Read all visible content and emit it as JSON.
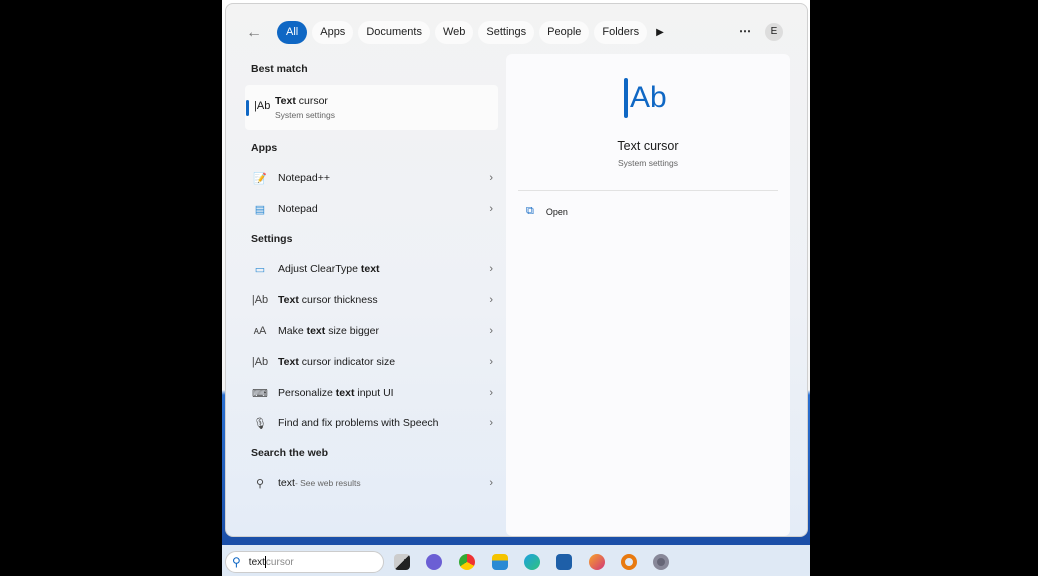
{
  "filters": {
    "items": [
      "All",
      "Apps",
      "Documents",
      "Web",
      "Settings",
      "People",
      "Folders"
    ],
    "active": "All",
    "more": "⋯",
    "avatar": "E"
  },
  "best_match": {
    "header": "Best match",
    "title_bold": "Text",
    "title_rest": " cursor",
    "subtitle": "System settings",
    "icon": "Ab"
  },
  "apps": {
    "header": "Apps",
    "items": [
      {
        "label": "Notepad++",
        "icon": "notepad-plus-plus-icon"
      },
      {
        "label": "Notepad",
        "icon": "notepad-icon"
      }
    ]
  },
  "settings": {
    "header": "Settings",
    "items": [
      {
        "pre": "Adjust ClearType ",
        "bold": "text",
        "post": "",
        "icon": "monitor-icon"
      },
      {
        "pre": "",
        "bold": "Text",
        "post": " cursor thickness",
        "icon": "text-cursor-icon"
      },
      {
        "pre": "Make ",
        "bold": "text",
        "post": " size bigger",
        "icon": "text-size-icon"
      },
      {
        "pre": "",
        "bold": "Text",
        "post": " cursor indicator size",
        "icon": "text-cursor-icon"
      },
      {
        "pre": "Personalize ",
        "bold": "text",
        "post": " input UI",
        "icon": "keyboard-icon"
      },
      {
        "pre": "Find and fix problems with Speech",
        "bold": "",
        "post": "",
        "icon": "microphone-icon"
      }
    ]
  },
  "web": {
    "header": "Search the web",
    "query": "text",
    "suffix": " - See web results"
  },
  "preview": {
    "title": "Text cursor",
    "subtitle": "System settings",
    "open": "Open",
    "icon": "Ab"
  },
  "taskbar": {
    "typed": "text",
    "placeholder": "cursor",
    "apps": [
      "task-view",
      "teams-chat",
      "chrome",
      "file-explorer",
      "edge",
      "store",
      "firefox",
      "search-tool",
      "settings"
    ]
  }
}
